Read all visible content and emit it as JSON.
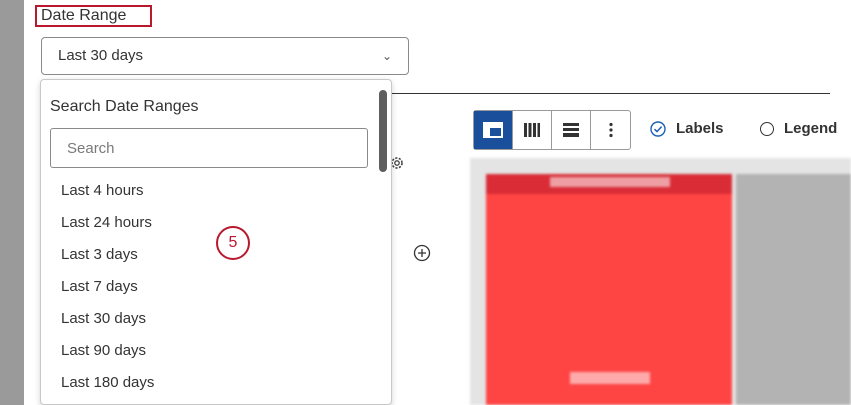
{
  "colors": {
    "accent": "#b8192e",
    "toolbar_active": "#1a4f9c",
    "chart_red": "#ff4444"
  },
  "filter": {
    "label": "Date Range",
    "selected_value": "Last 30 days",
    "chevron_icon": "chevron-down-icon"
  },
  "dropdown": {
    "title": "Search Date Ranges",
    "search_placeholder": "Search",
    "options": [
      "Last 4 hours",
      "Last 24 hours",
      "Last 3 days",
      "Last 7 days",
      "Last 30 days",
      "Last 90 days",
      "Last 180 days"
    ]
  },
  "step_badge": "5",
  "toolbar": {
    "buttons": [
      "table-layout-icon",
      "columns-icon",
      "rows-icon",
      "more-vertical-icon"
    ],
    "active_index": 0
  },
  "display_options": {
    "labels": {
      "text": "Labels",
      "checked": true
    },
    "legend": {
      "text": "Legend",
      "checked": false
    }
  }
}
